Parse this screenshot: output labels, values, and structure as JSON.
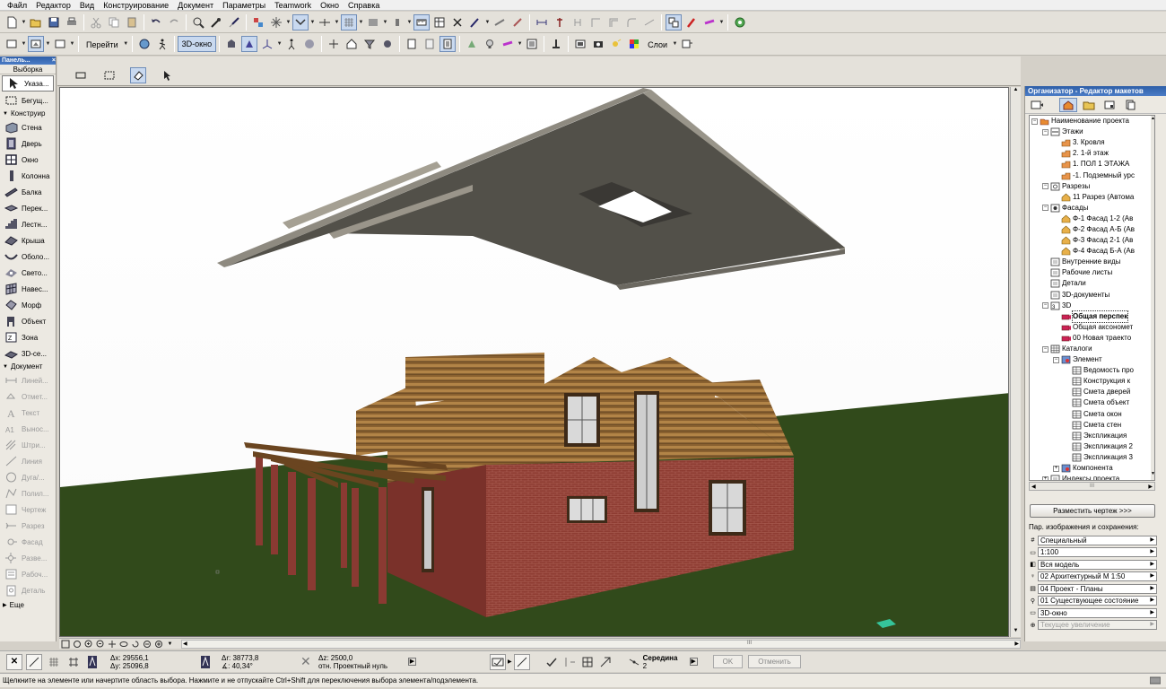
{
  "menu": [
    "Файл",
    "Редактор",
    "Вид",
    "Конструирование",
    "Документ",
    "Параметры",
    "Teamwork",
    "Окно",
    "Справка"
  ],
  "toolbar2": {
    "goto_label": "Перейти",
    "view3d_label": "3D-окно",
    "layers_label": "Слои"
  },
  "toolbox": {
    "title": "Панель...",
    "close": "×",
    "select_header": "Выборка",
    "items_top": [
      {
        "label": "Указа...",
        "icon": "arrow-pointer-icon"
      },
      {
        "label": "Бегущ...",
        "icon": "marquee-icon"
      }
    ],
    "cat_construct": "Конструир",
    "items_construct": [
      {
        "label": "Стена",
        "icon": "wall-icon"
      },
      {
        "label": "Дверь",
        "icon": "door-icon"
      },
      {
        "label": "Окно",
        "icon": "window-icon"
      },
      {
        "label": "Колонна",
        "icon": "column-icon"
      },
      {
        "label": "Балка",
        "icon": "beam-icon"
      },
      {
        "label": "Перек...",
        "icon": "slab-icon"
      },
      {
        "label": "Лестн...",
        "icon": "stair-icon"
      },
      {
        "label": "Крыша",
        "icon": "roof-icon"
      },
      {
        "label": "Оболо...",
        "icon": "shell-icon"
      },
      {
        "label": "Свето...",
        "icon": "skylight-icon"
      },
      {
        "label": "Навес...",
        "icon": "curtain-wall-icon"
      },
      {
        "label": "Морф",
        "icon": "morph-icon"
      },
      {
        "label": "Объект",
        "icon": "object-icon"
      },
      {
        "label": "Зона",
        "icon": "zone-icon"
      },
      {
        "label": "3D-се...",
        "icon": "mesh-icon"
      }
    ],
    "cat_document": "Документ",
    "items_document": [
      {
        "label": "Линей...",
        "icon": "dimension-icon"
      },
      {
        "label": "Отмет...",
        "icon": "level-dim-icon"
      },
      {
        "label": "Текст",
        "icon": "text-icon"
      },
      {
        "label": "Вынос...",
        "icon": "label-icon"
      },
      {
        "label": "Штри...",
        "icon": "fill-icon"
      },
      {
        "label": "Линия",
        "icon": "line-icon"
      },
      {
        "label": "Дуга/...",
        "icon": "arc-icon"
      },
      {
        "label": "Полил...",
        "icon": "polyline-icon"
      },
      {
        "label": "Чертеж",
        "icon": "drawing-icon"
      },
      {
        "label": "Разрез",
        "icon": "section-icon"
      },
      {
        "label": "Фасад",
        "icon": "elevation-icon"
      },
      {
        "label": "Разве...",
        "icon": "interior-elevation-icon"
      },
      {
        "label": "Рабоч...",
        "icon": "worksheet-icon"
      },
      {
        "label": "Деталь",
        "icon": "detail-icon"
      }
    ],
    "more": "Еще"
  },
  "organizer": {
    "title": "Организатор - Редактор макетов",
    "tree": [
      {
        "d": 0,
        "pm": "-",
        "icon": "folder",
        "label": "Наименование проекта"
      },
      {
        "d": 1,
        "pm": "-",
        "icon": "stories",
        "label": "Этажи"
      },
      {
        "d": 2,
        "pm": "",
        "icon": "story",
        "label": "3. Кровля"
      },
      {
        "d": 2,
        "pm": "",
        "icon": "story",
        "label": "2. 1-й этаж"
      },
      {
        "d": 2,
        "pm": "",
        "icon": "story",
        "label": "1. ПОЛ 1 ЭТАЖА"
      },
      {
        "d": 2,
        "pm": "",
        "icon": "story",
        "label": "-1. Подземный урс"
      },
      {
        "d": 1,
        "pm": "-",
        "icon": "sections",
        "label": "Разрезы"
      },
      {
        "d": 2,
        "pm": "",
        "icon": "view",
        "label": "11 Разрез (Автома"
      },
      {
        "d": 1,
        "pm": "-",
        "icon": "elevations",
        "label": "Фасады"
      },
      {
        "d": 2,
        "pm": "",
        "icon": "view",
        "label": "Ф-1 Фасад 1-2 (Ав"
      },
      {
        "d": 2,
        "pm": "",
        "icon": "view",
        "label": "Ф-2 Фасад А-Б (Ав"
      },
      {
        "d": 2,
        "pm": "",
        "icon": "view",
        "label": "Ф-3 Фасад 2-1 (Ав"
      },
      {
        "d": 2,
        "pm": "",
        "icon": "view",
        "label": "Ф-4 Фасад Б-А (Ав"
      },
      {
        "d": 1,
        "pm": "",
        "icon": "box",
        "label": "Внутренние виды"
      },
      {
        "d": 1,
        "pm": "",
        "icon": "box",
        "label": "Рабочие листы"
      },
      {
        "d": 1,
        "pm": "",
        "icon": "box",
        "label": "Детали"
      },
      {
        "d": 1,
        "pm": "",
        "icon": "box",
        "label": "3D-документы"
      },
      {
        "d": 1,
        "pm": "-",
        "icon": "box3d",
        "label": "3D"
      },
      {
        "d": 2,
        "pm": "",
        "icon": "camera",
        "label": "Общая перспек",
        "sel": true
      },
      {
        "d": 2,
        "pm": "",
        "icon": "camera",
        "label": "Общая аксономет"
      },
      {
        "d": 2,
        "pm": "",
        "icon": "camera",
        "label": "00 Новая траекто"
      },
      {
        "d": 1,
        "pm": "-",
        "icon": "catalog",
        "label": "Каталоги"
      },
      {
        "d": 2,
        "pm": "-",
        "icon": "element",
        "label": "Элемент"
      },
      {
        "d": 3,
        "pm": "",
        "icon": "table",
        "label": "Ведомость про"
      },
      {
        "d": 3,
        "pm": "",
        "icon": "table",
        "label": "Конструкция к"
      },
      {
        "d": 3,
        "pm": "",
        "icon": "table",
        "label": "Смета дверей"
      },
      {
        "d": 3,
        "pm": "",
        "icon": "table",
        "label": "Смета объект"
      },
      {
        "d": 3,
        "pm": "",
        "icon": "table",
        "label": "Смета окон"
      },
      {
        "d": 3,
        "pm": "",
        "icon": "table",
        "label": "Смета стен"
      },
      {
        "d": 3,
        "pm": "",
        "icon": "table",
        "label": "Экспликация"
      },
      {
        "d": 3,
        "pm": "",
        "icon": "table",
        "label": "Экспликация 2"
      },
      {
        "d": 3,
        "pm": "",
        "icon": "table",
        "label": "Экспликация 3"
      },
      {
        "d": 2,
        "pm": "+",
        "icon": "element",
        "label": "Компонента"
      },
      {
        "d": 1,
        "pm": "+",
        "icon": "box",
        "label": "Индексы проекта"
      }
    ],
    "scroll_mid": "III",
    "place_button": "Разместить чертеж >>>",
    "params_label": "Пар. изображения и сохранения:",
    "params": [
      {
        "icon": "#",
        "value": "Специальный"
      },
      {
        "icon": "▭",
        "value": "1:100"
      },
      {
        "icon": "◧",
        "value": "Вся модель"
      },
      {
        "icon": "♀",
        "value": "02 Архитектурный М 1:50"
      },
      {
        "icon": "▤",
        "value": "04 Проект - Планы"
      },
      {
        "icon": "⚲",
        "value": "01 Существующее состояние"
      },
      {
        "icon": "▭",
        "value": "3D-окно"
      },
      {
        "icon": "⊕",
        "value": "Текущее увеличение",
        "disabled": true
      }
    ]
  },
  "coords": {
    "dx": "Δx: 29556,1",
    "dy": "Δy: 25096,8",
    "dr": "Δr: 38773,8",
    "angle": "∡: 40,34°",
    "dz": "Δz: 2500,0",
    "ref": "отн. Проектный нуль",
    "snap_label": "Середина",
    "snap_val": "2",
    "ok": "OK",
    "cancel": "Отменить"
  },
  "status": "Щелкните на элементе или начертите область выбора. Нажмите и не отпускайте Ctrl+Shift для переключения выбора элемента/подэлемента."
}
